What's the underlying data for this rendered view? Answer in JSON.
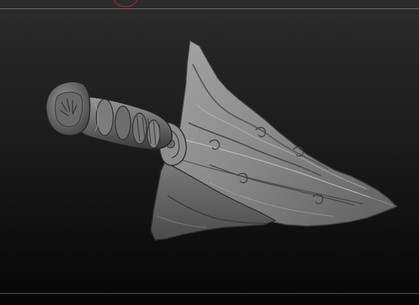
{
  "viewport": {
    "background_top_color": "#2c2c2c",
    "background_bottom_color": "#060606"
  },
  "model": {
    "object_icon": "dagger-sculpt",
    "material_color": "#8a8a8a"
  },
  "cursor": {
    "icon": "brush-cursor-ring",
    "color": "#c0282a"
  }
}
